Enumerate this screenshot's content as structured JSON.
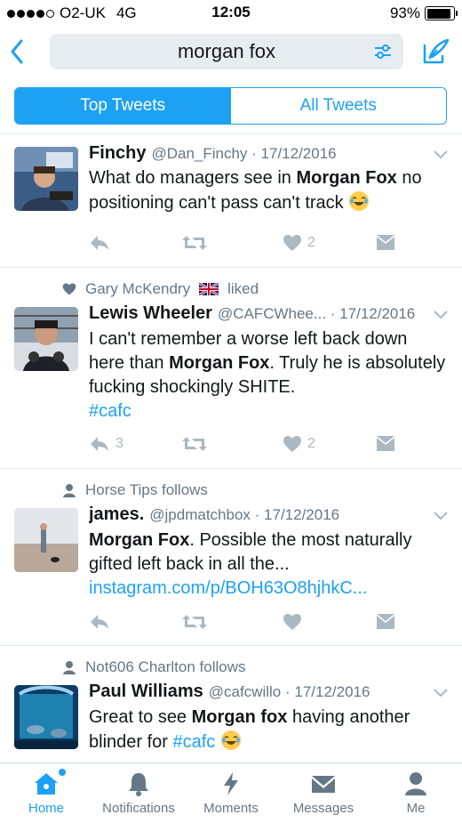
{
  "status_bar": {
    "carrier": "O2-UK",
    "network": "4G",
    "time": "12:05",
    "battery_percent": "93%",
    "battery_level": 0.93
  },
  "nav": {
    "search_query": "morgan fox",
    "back_icon": "chevron-left-icon",
    "filter_icon": "sliders-icon",
    "compose_icon": "compose-icon"
  },
  "segmented": {
    "top_label": "Top Tweets",
    "all_label": "All Tweets"
  },
  "tweets": [
    {
      "name": "Finchy",
      "handle": "@Dan_Finchy",
      "date": "· 17/12/2016",
      "text_pre": "What do managers see in ",
      "text_bold": "Morgan Fox",
      "text_post": " no positioning can't pass can't track",
      "reply_count": "",
      "retweet_count": "",
      "like_count": "2"
    },
    {
      "context": "Gary McKendry",
      "context_suffix": "liked",
      "name": "Lewis Wheeler",
      "handle": "@CAFCWhee...",
      "date": "· 17/12/2016",
      "text_pre": "I can't remember a worse left back down here than ",
      "text_bold": "Morgan Fox",
      "text_post": ". Truly he is absolutely fucking shockingly SHITE.",
      "hashtag": "#cafc",
      "reply_count": "3",
      "like_count": "2"
    },
    {
      "context": "Horse Tips follows",
      "name": "james.",
      "handle": "@jpdmatchbox",
      "date": "· 17/12/2016",
      "text_bold": "Morgan Fox",
      "text_post": ". Possible the most naturally gifted left back in all the...",
      "link": "instagram.com/p/BOH63O8hjhkC...",
      "reply_count": "",
      "like_count": ""
    },
    {
      "context": "Not606 Charlton follows",
      "name": "Paul Williams",
      "handle": "@cafcwillo",
      "date": "· 17/12/2016",
      "text_pre": "Great to see ",
      "text_bold": "Morgan fox",
      "text_post": " having another blinder for ",
      "hashtag": "#cafc"
    }
  ],
  "tabbar": {
    "home": "Home",
    "notifications": "Notifications",
    "moments": "Moments",
    "messages": "Messages",
    "me": "Me"
  },
  "colors": {
    "accent": "#1da1f2",
    "muted": "#657786",
    "icon_gray": "#aab8c2"
  }
}
